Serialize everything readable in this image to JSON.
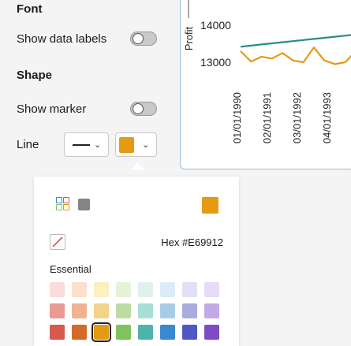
{
  "panel": {
    "font_section": "Font",
    "show_data_labels": {
      "label": "Show data labels",
      "on": false
    },
    "shape_section": "Shape",
    "show_marker": {
      "label": "Show marker",
      "on": false
    },
    "line": {
      "label": "Line",
      "style": "solid",
      "color": "#E69912"
    }
  },
  "chart_data": {
    "type": "line",
    "ylabel": "Profit",
    "y_ticks": [
      "14000",
      "13000"
    ],
    "x_ticks": [
      "01/01/1990",
      "02/01/1991",
      "03/01/1992",
      "04/01/1993"
    ],
    "series": [
      {
        "color": "#2a8c86",
        "values": [
          13420,
          13450,
          13480,
          13510,
          13540,
          13570,
          13600,
          13630,
          13660,
          13690,
          13720,
          13750
        ]
      },
      {
        "color": "#E69912",
        "values": [
          13300,
          13020,
          13150,
          13100,
          13250,
          13050,
          13000,
          13400,
          13050,
          12950,
          13000,
          13300
        ]
      }
    ]
  },
  "color_picker": {
    "current_color": "#E69912",
    "hex_label": "Hex #E69912",
    "palette_title": "Essential",
    "rows": [
      [
        "#f9dcdc",
        "#fbe0cc",
        "#fdf0c0",
        "#e6f2d7",
        "#def1ef",
        "#dcebf5",
        "#e0e1f6",
        "#e7dbf7"
      ],
      [
        "#e99b93",
        "#f0b290",
        "#f3d28b",
        "#bcdca4",
        "#a9ddd7",
        "#a7cde6",
        "#a8acde",
        "#c2a9e8"
      ],
      [
        "#d9584e",
        "#d5692a",
        "#E69912",
        "#7ec35c",
        "#4fb3ad",
        "#3a88cf",
        "#4e57c4",
        "#7e4bc4"
      ]
    ],
    "selected": [
      2,
      2
    ]
  }
}
